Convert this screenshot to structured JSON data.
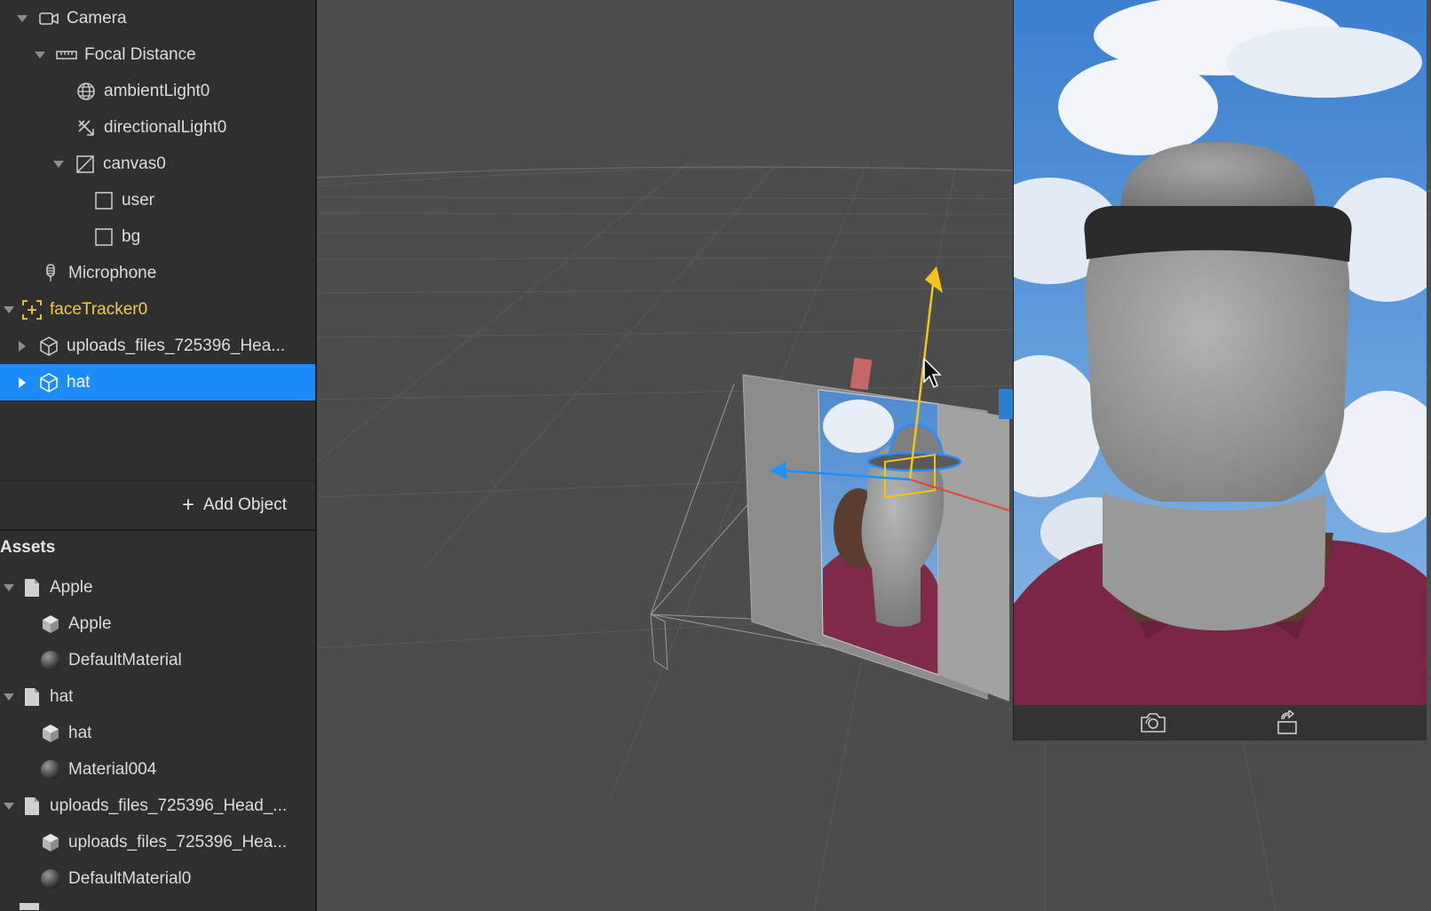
{
  "scene": {
    "items": [
      {
        "label": "Camera",
        "icon": "camera-icon"
      },
      {
        "label": "Focal Distance",
        "icon": "ruler-icon"
      },
      {
        "label": "ambientLight0",
        "icon": "globe-icon"
      },
      {
        "label": "directionalLight0",
        "icon": "directional-light-icon"
      },
      {
        "label": "canvas0",
        "icon": "canvas-icon"
      },
      {
        "label": "user",
        "icon": "rectangle-icon"
      },
      {
        "label": "bg",
        "icon": "rectangle-icon"
      },
      {
        "label": "Microphone",
        "icon": "microphone-icon"
      },
      {
        "label": "faceTracker0",
        "icon": "face-tracker-icon"
      },
      {
        "label": "uploads_files_725396_Hea...",
        "icon": "cube-icon"
      },
      {
        "label": "hat",
        "icon": "cube-icon",
        "selected": true
      }
    ],
    "add_object_label": "Add Object"
  },
  "assets": {
    "title": "Assets",
    "items": [
      {
        "label": "Apple",
        "icon": "file-icon"
      },
      {
        "label": "Apple",
        "icon": "mesh-icon"
      },
      {
        "label": "DefaultMaterial",
        "icon": "material-sphere-icon"
      },
      {
        "label": "hat",
        "icon": "file-icon"
      },
      {
        "label": "hat",
        "icon": "mesh-icon"
      },
      {
        "label": "Material004",
        "icon": "material-sphere-icon"
      },
      {
        "label": "uploads_files_725396_Head_...",
        "icon": "file-icon"
      },
      {
        "label": "uploads_files_725396_Hea...",
        "icon": "mesh-icon"
      },
      {
        "label": "DefaultMaterial0",
        "icon": "material-sphere-icon"
      }
    ]
  },
  "simulator": {
    "buttons": [
      "capture-photo-icon",
      "rotate-device-icon"
    ]
  },
  "colors": {
    "selection": "#1d8cf8",
    "face_tracker": "#f7c948",
    "gizmo_y": "#f5c518",
    "gizmo_x": "#1e90ff"
  }
}
